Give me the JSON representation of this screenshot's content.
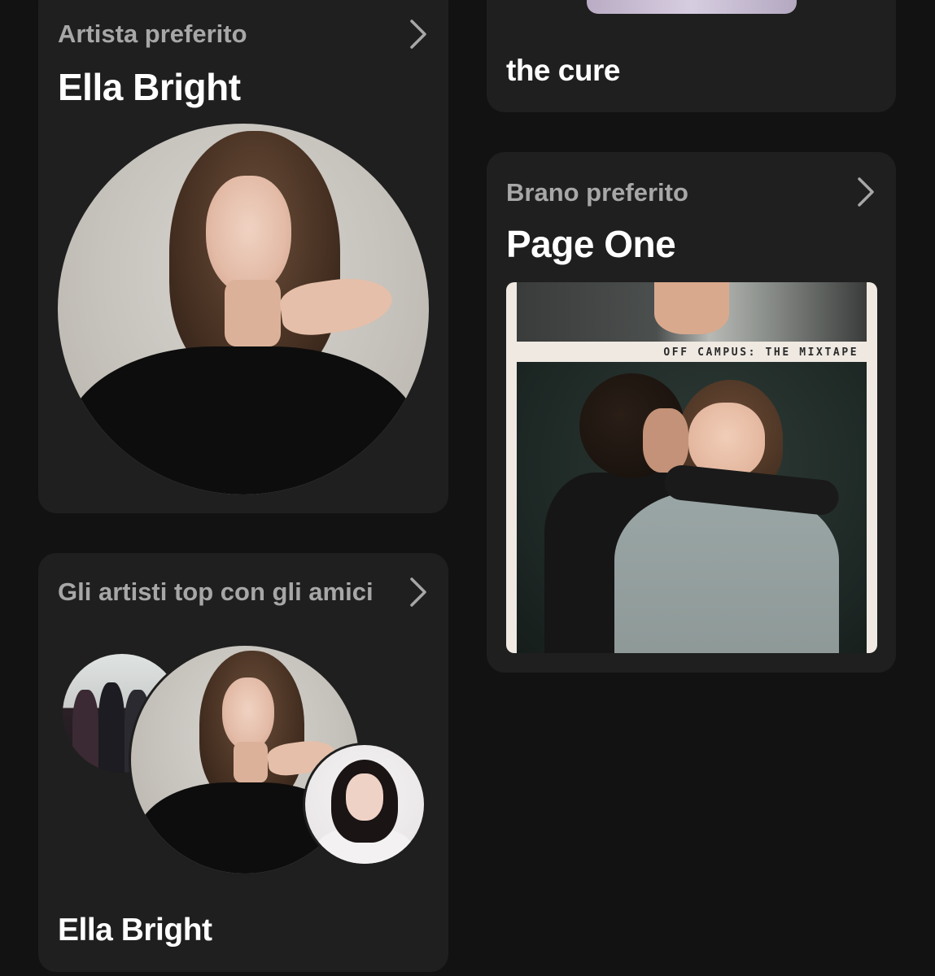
{
  "top_right_card": {
    "title": "the cure"
  },
  "favorite_artist_card": {
    "subtitle": "Artista preferito",
    "title": "Ella Bright",
    "image_alt": "Ella Bright portrait"
  },
  "favorite_song_card": {
    "subtitle": "Brano preferito",
    "title": "Page One",
    "album_caption": "OFF CAMPUS: THE MIXTAPE"
  },
  "top_artists_friends_card": {
    "subtitle": "Gli artisti top con gli amici",
    "title": "Ella Bright"
  },
  "icons": {
    "chevron": "chevron-right-icon"
  },
  "colors": {
    "background": "#121212",
    "card": "#1f1f1f",
    "subtitle": "#a7a7a7",
    "title": "#ffffff"
  }
}
